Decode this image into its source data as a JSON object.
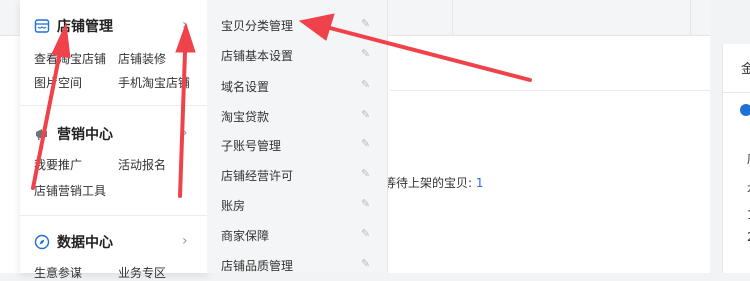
{
  "menu": {
    "sections": [
      {
        "icon": "shop-icon",
        "title": "店铺管理",
        "links": [
          "查看淘宝店铺",
          "店铺装修",
          "图片空间",
          "手机淘宝店铺"
        ]
      },
      {
        "icon": "megaphone-icon",
        "title": "营销中心",
        "links": [
          "我要推广",
          "活动报名",
          "店铺营销工具"
        ]
      },
      {
        "icon": "compass-icon",
        "title": "数据中心",
        "links": [
          "生意参谋",
          "业务专区"
        ]
      }
    ],
    "submenu": [
      "宝贝分类管理",
      "店铺基本设置",
      "域名设置",
      "淘宝贷款",
      "子账号管理",
      "店铺经营许可",
      "账房",
      "商家保障",
      "店铺品质管理"
    ]
  },
  "content": {
    "waiting_label": "等待上架的宝贝:",
    "waiting_count": "1"
  },
  "right_panel": {
    "title": "金",
    "line1": "店",
    "line2": "本",
    "line3": "1",
    "line4": "2"
  },
  "colors": {
    "annotation_arrow": "#f0424a",
    "link_blue": "#1f6fd6"
  }
}
